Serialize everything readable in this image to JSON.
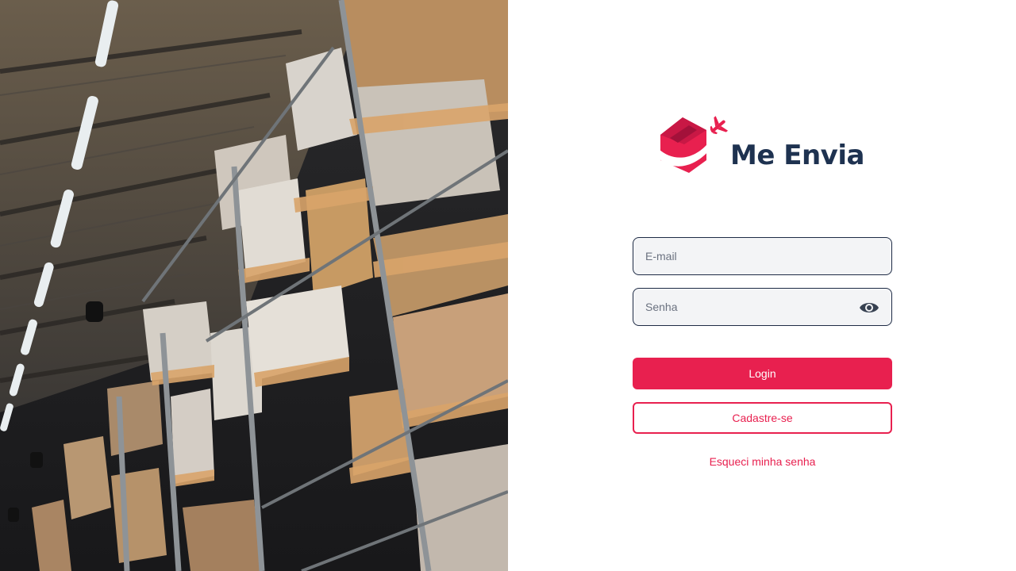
{
  "brand": {
    "name": "Me Envia",
    "primary_color": "#e8204f",
    "text_color": "#1e3250",
    "logo_icon": "box-airplane-logo-icon"
  },
  "hero_image": {
    "icon": "warehouse-photo"
  },
  "form": {
    "email_placeholder": "E-mail",
    "password_placeholder": "Senha",
    "password_toggle_icon": "eye-icon",
    "login_label": "Login",
    "signup_label": "Cadastre-se",
    "forgot_label": "Esqueci minha senha"
  }
}
